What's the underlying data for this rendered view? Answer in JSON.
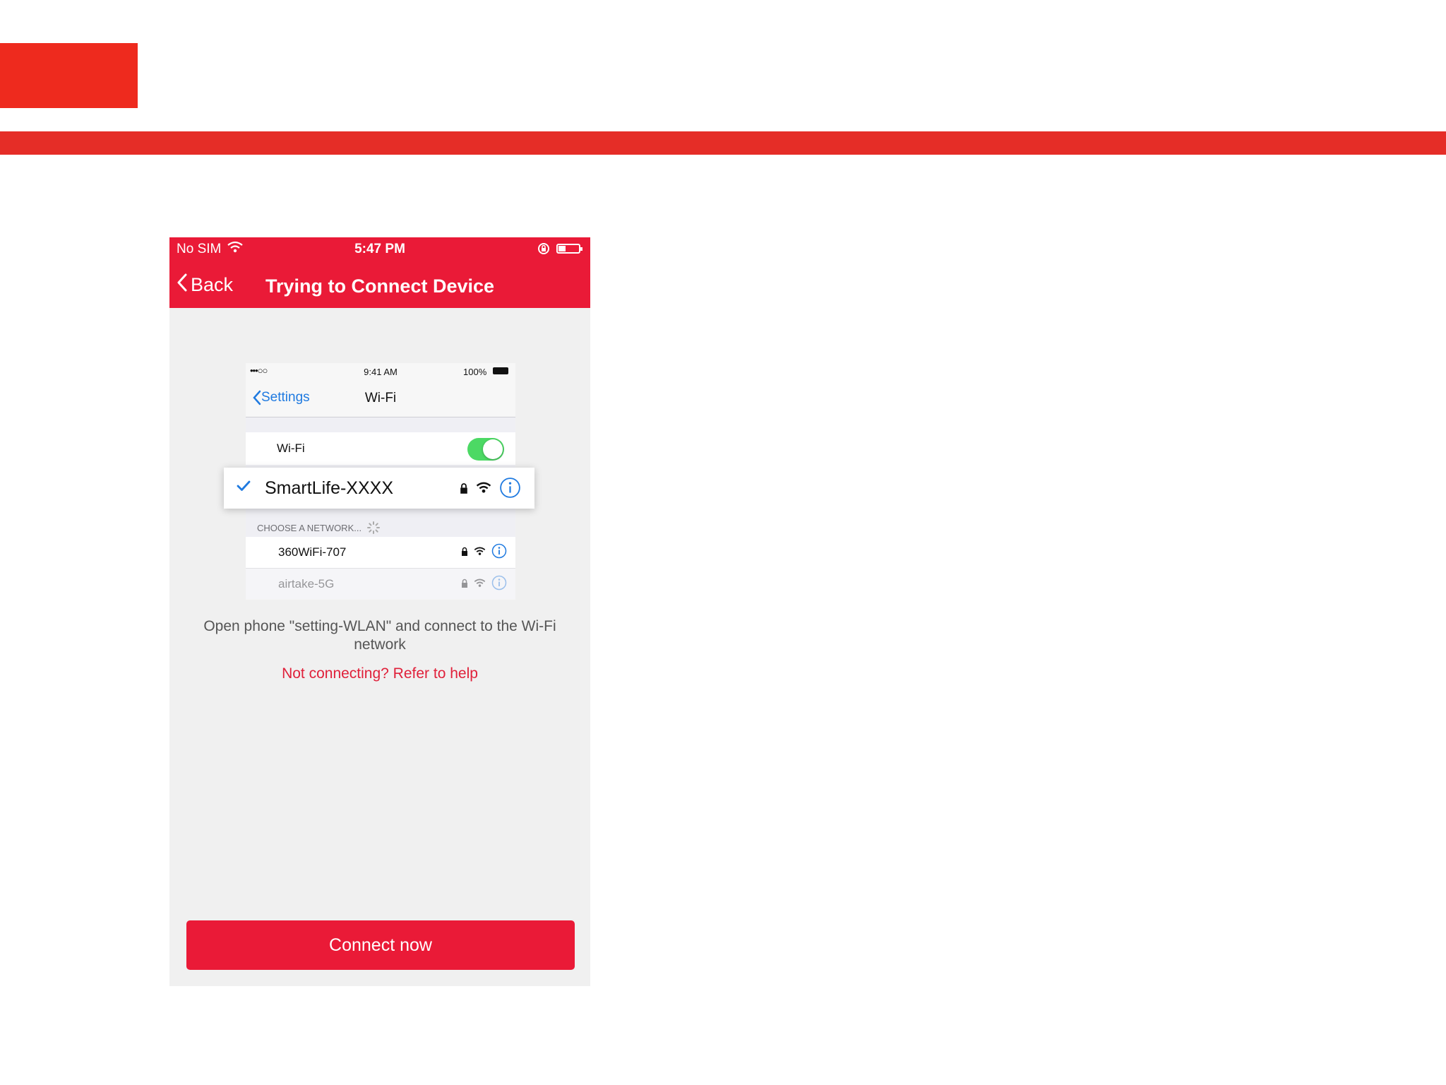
{
  "colors": {
    "brand_red": "#ea1a37",
    "slide_red": "#e52d27",
    "ios_blue": "#1f7ae0",
    "toggle_green": "#4cd964"
  },
  "phone": {
    "status_bar": {
      "carrier": "No SIM",
      "time": "5:47 PM",
      "icons": [
        "wifi-icon",
        "orientation-lock-icon",
        "battery-icon"
      ]
    },
    "nav": {
      "back_label": "Back",
      "title": "Trying to Connect Device"
    },
    "illustration": {
      "status": {
        "signal": "•••○○",
        "time": "9:41 AM",
        "battery": "100%"
      },
      "back_label": "Settings",
      "title": "Wi-Fi",
      "wifi_label": "Wi-Fi",
      "wifi_on": true,
      "selected_network": "SmartLife-XXXX",
      "section_header": "CHOOSE A NETWORK...",
      "networks": [
        "360WiFi-707",
        "airtake-5G"
      ]
    },
    "instruction": "Open phone \"setting-WLAN\" and connect to the Wi-Fi network",
    "help_link": "Not connecting? Refer to help",
    "connect_button": "Connect now"
  }
}
